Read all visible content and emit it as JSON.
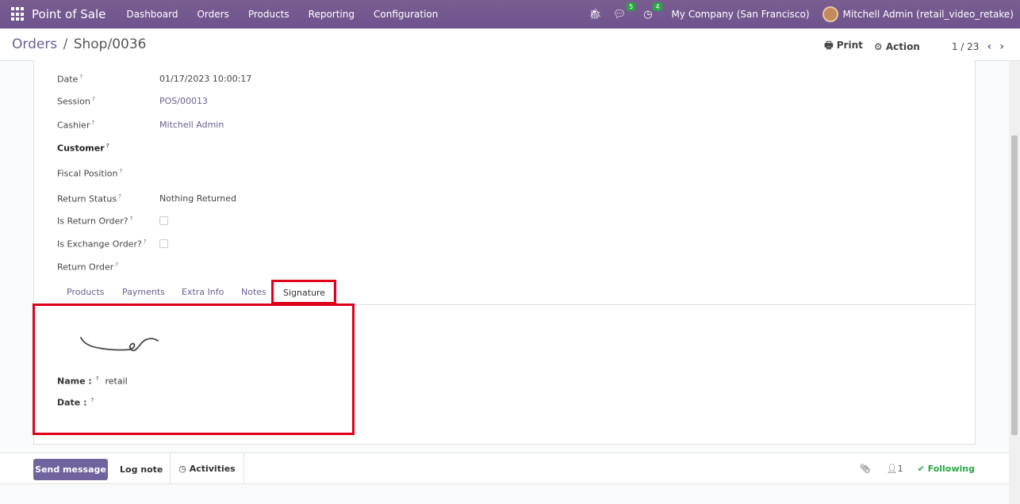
{
  "navbar": {
    "brand": "Point of Sale",
    "menu": [
      "Dashboard",
      "Orders",
      "Products",
      "Reporting",
      "Configuration"
    ],
    "messages_badge": "5",
    "activities_badge": "4",
    "company": "My Company (San Francisco)",
    "user": "Mitchell Admin (retail_video_retake)"
  },
  "breadcrumb": {
    "parent": "Orders",
    "separator": "/",
    "current": "Shop/0036"
  },
  "control": {
    "print": "Print",
    "action": "Action",
    "pager": "1 / 23"
  },
  "fields": {
    "date_label": "Date",
    "date_value": "01/17/2023 10:00:17",
    "session_label": "Session",
    "session_value": "POS/00013",
    "cashier_label": "Cashier",
    "cashier_value": "Mitchell Admin",
    "customer_label": "Customer",
    "fiscal_label": "Fiscal Position",
    "return_status_label": "Return Status",
    "return_status_value": "Nothing Returned",
    "is_return_label": "Is Return Order?",
    "is_exchange_label": "Is Exchange Order?",
    "return_order_label": "Return Order",
    "help": "?"
  },
  "tabs": [
    "Products",
    "Payments",
    "Extra Info",
    "Notes",
    "Signature"
  ],
  "signature": {
    "name_label": "Name :",
    "name_value": "retail",
    "date_label": "Date :"
  },
  "chatter": {
    "send": "Send message",
    "log": "Log note",
    "activities": "Activities",
    "followers": "1",
    "following": "Following"
  }
}
